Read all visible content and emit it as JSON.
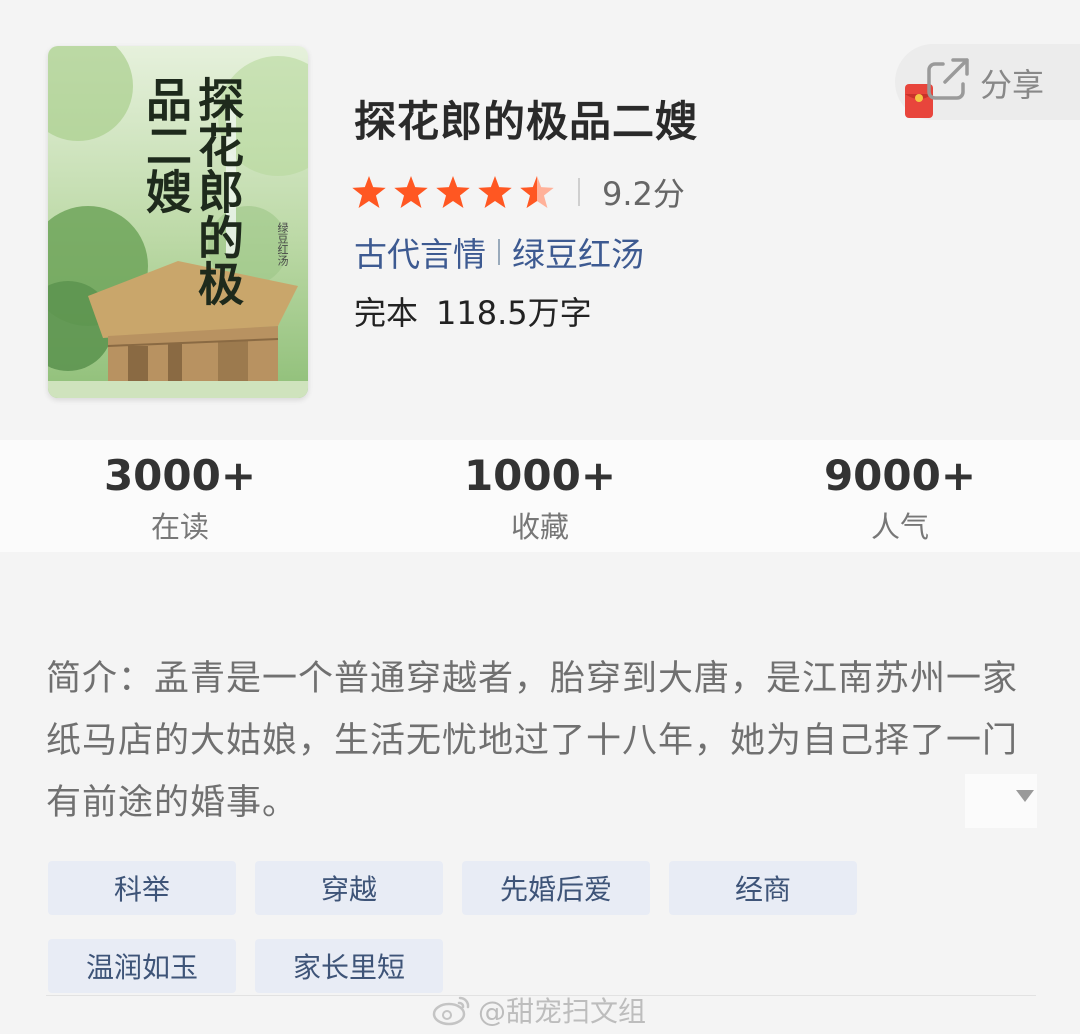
{
  "book": {
    "title": "探花郎的极品二嫂",
    "cover": {
      "title_text": "探花郎的极品二嫂",
      "author_signature": "绿豆红汤"
    },
    "rating": {
      "stars": 4.5,
      "max_stars": 5,
      "score": "9.2分"
    },
    "categories": [
      "古代言情",
      "绿豆红汤"
    ],
    "status": "完本",
    "word_count": "118.5万字"
  },
  "share": {
    "label": "分享",
    "icon": "share-icon",
    "badge_icon": "red-envelope-icon"
  },
  "stats": [
    {
      "value": "3000+",
      "label": "在读"
    },
    {
      "value": "1000+",
      "label": "收藏"
    },
    {
      "value": "9000+",
      "label": "人气"
    }
  ],
  "intro": {
    "text": "简介：孟青是一个普通穿越者，胎穿到大唐，是江南苏州一家纸马店的大姑娘，生活无忧地过了十八年，她为自己择了一门有前途的婚事。"
  },
  "tags": [
    "科举",
    "穿越",
    "先婚后爱",
    "经商",
    "温润如玉",
    "家长里短"
  ],
  "watermark": "@甜宠扫文组",
  "colors": {
    "accent_link": "#3d5a91",
    "star": "#ff5722",
    "tag_bg": "#e8ecf5",
    "tag_text": "#3e5478"
  }
}
